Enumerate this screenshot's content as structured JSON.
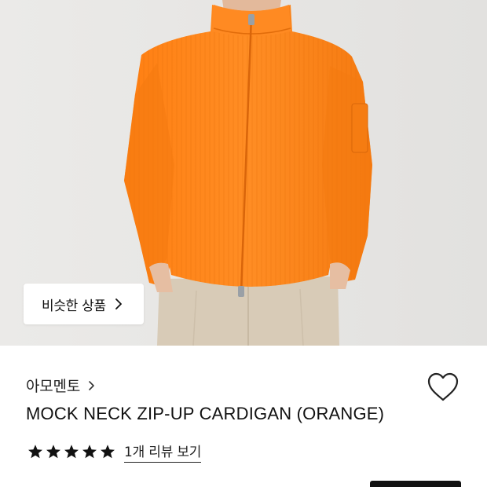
{
  "hero": {
    "background": "#e7e6e4",
    "garment_color": "#ff8a1f",
    "pants_color": "#d9ccb8"
  },
  "similar_button": {
    "label": "비슷한 상품",
    "icon": "chevron-right-icon"
  },
  "product": {
    "brand": "아모멘토",
    "brand_icon": "chevron-right-icon",
    "title": "MOCK NECK ZIP-UP CARDIGAN (ORANGE)",
    "rating": 5,
    "rating_max": 5,
    "review_link": "1개 리뷰 보기",
    "wishlist_icon": "heart-outline-icon"
  }
}
